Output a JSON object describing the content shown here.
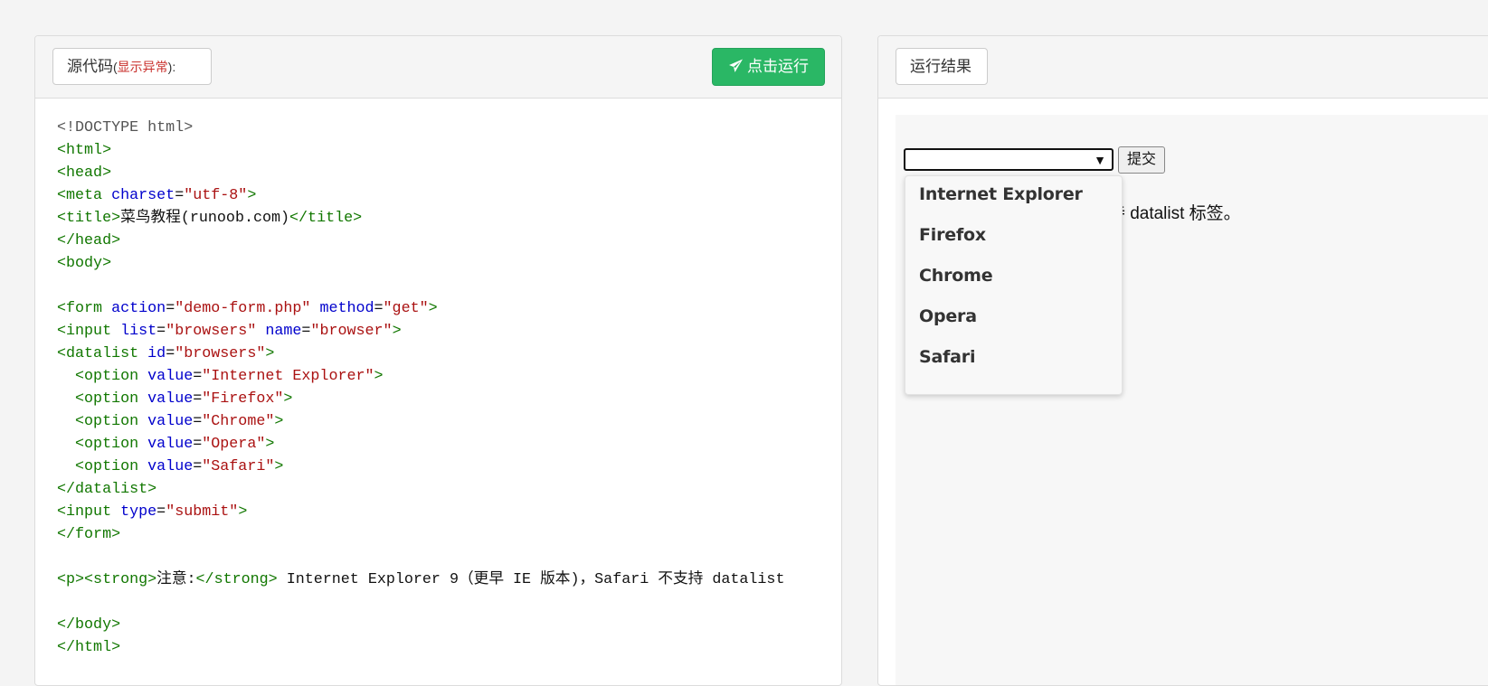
{
  "source_panel": {
    "label_main": "源代码",
    "label_paren_open": "(",
    "label_error": "显示异常",
    "label_paren_close": "):",
    "run_button": "点击运行"
  },
  "code_lines": [
    [
      {
        "t": "<!DOCTYPE html>",
        "c": "doc"
      }
    ],
    [
      {
        "t": "<html>",
        "c": "tag"
      }
    ],
    [
      {
        "t": "<head>",
        "c": "tag"
      }
    ],
    [
      {
        "t": "<meta ",
        "c": "tag"
      },
      {
        "t": "charset",
        "c": "attr"
      },
      {
        "t": "=",
        "c": "txt"
      },
      {
        "t": "\"utf-8\"",
        "c": "str"
      },
      {
        "t": ">",
        "c": "tag"
      }
    ],
    [
      {
        "t": "<title>",
        "c": "tag"
      },
      {
        "t": "菜鸟教程(runoob.com)",
        "c": "txt"
      },
      {
        "t": "</title>",
        "c": "tag"
      }
    ],
    [
      {
        "t": "</head>",
        "c": "tag"
      }
    ],
    [
      {
        "t": "<body>",
        "c": "tag"
      }
    ],
    [],
    [
      {
        "t": "<form ",
        "c": "tag"
      },
      {
        "t": "action",
        "c": "attr"
      },
      {
        "t": "=",
        "c": "txt"
      },
      {
        "t": "\"demo-form.php\"",
        "c": "str"
      },
      {
        "t": " ",
        "c": "txt"
      },
      {
        "t": "method",
        "c": "attr"
      },
      {
        "t": "=",
        "c": "txt"
      },
      {
        "t": "\"get\"",
        "c": "str"
      },
      {
        "t": ">",
        "c": "tag"
      }
    ],
    [
      {
        "t": "<input ",
        "c": "tag"
      },
      {
        "t": "list",
        "c": "attr"
      },
      {
        "t": "=",
        "c": "txt"
      },
      {
        "t": "\"browsers\"",
        "c": "str"
      },
      {
        "t": " ",
        "c": "txt"
      },
      {
        "t": "name",
        "c": "attr"
      },
      {
        "t": "=",
        "c": "txt"
      },
      {
        "t": "\"browser\"",
        "c": "str"
      },
      {
        "t": ">",
        "c": "tag"
      }
    ],
    [
      {
        "t": "<datalist ",
        "c": "tag"
      },
      {
        "t": "id",
        "c": "attr"
      },
      {
        "t": "=",
        "c": "txt"
      },
      {
        "t": "\"browsers\"",
        "c": "str"
      },
      {
        "t": ">",
        "c": "tag"
      }
    ],
    [
      {
        "t": "  <option ",
        "c": "tag"
      },
      {
        "t": "value",
        "c": "attr"
      },
      {
        "t": "=",
        "c": "txt"
      },
      {
        "t": "\"Internet Explorer\"",
        "c": "str"
      },
      {
        "t": ">",
        "c": "tag"
      }
    ],
    [
      {
        "t": "  <option ",
        "c": "tag"
      },
      {
        "t": "value",
        "c": "attr"
      },
      {
        "t": "=",
        "c": "txt"
      },
      {
        "t": "\"Firefox\"",
        "c": "str"
      },
      {
        "t": ">",
        "c": "tag"
      }
    ],
    [
      {
        "t": "  <option ",
        "c": "tag"
      },
      {
        "t": "value",
        "c": "attr"
      },
      {
        "t": "=",
        "c": "txt"
      },
      {
        "t": "\"Chrome\"",
        "c": "str"
      },
      {
        "t": ">",
        "c": "tag"
      }
    ],
    [
      {
        "t": "  <option ",
        "c": "tag"
      },
      {
        "t": "value",
        "c": "attr"
      },
      {
        "t": "=",
        "c": "txt"
      },
      {
        "t": "\"Opera\"",
        "c": "str"
      },
      {
        "t": ">",
        "c": "tag"
      }
    ],
    [
      {
        "t": "  <option ",
        "c": "tag"
      },
      {
        "t": "value",
        "c": "attr"
      },
      {
        "t": "=",
        "c": "txt"
      },
      {
        "t": "\"Safari\"",
        "c": "str"
      },
      {
        "t": ">",
        "c": "tag"
      }
    ],
    [
      {
        "t": "</datalist>",
        "c": "tag"
      }
    ],
    [
      {
        "t": "<input ",
        "c": "tag"
      },
      {
        "t": "type",
        "c": "attr"
      },
      {
        "t": "=",
        "c": "txt"
      },
      {
        "t": "\"submit\"",
        "c": "str"
      },
      {
        "t": ">",
        "c": "tag"
      }
    ],
    [
      {
        "t": "</form>",
        "c": "tag"
      }
    ],
    [],
    [
      {
        "t": "<p><strong>",
        "c": "tag"
      },
      {
        "t": "注意:",
        "c": "txt"
      },
      {
        "t": "</strong>",
        "c": "tag"
      },
      {
        "t": " Internet Explorer 9（更早 IE 版本)，Safari 不支持 datalist",
        "c": "txt"
      }
    ],
    [],
    [
      {
        "t": "</body>",
        "c": "tag"
      }
    ],
    [
      {
        "t": "</html>",
        "c": "tag"
      }
    ]
  ],
  "result_panel": {
    "label": "运行结果",
    "submit_button": "提交",
    "input_value": "",
    "dropdown_arrow": "▼",
    "note_visible": "更早 IE 版本），Safari 不支持 datalist 标签。",
    "dropdown_options": [
      "Internet Explorer",
      "Firefox",
      "Chrome",
      "Opera",
      "Safari"
    ]
  },
  "colors": {
    "run_button_bg": "#2ab765",
    "tag": "#117700",
    "attr": "#0000cc",
    "string": "#aa1111",
    "error_label": "#c9302c"
  },
  "icons": {
    "run_button_icon": "paper-plane-icon",
    "select_arrow_icon": "triangle-down-icon"
  }
}
